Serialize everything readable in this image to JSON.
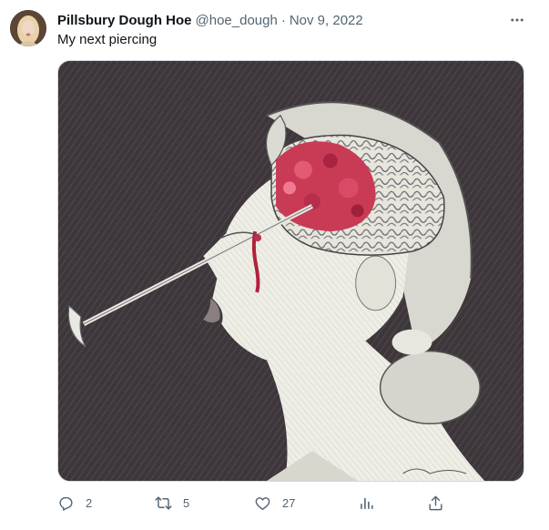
{
  "author": {
    "display_name": "Pillsbury Dough Hoe",
    "handle": "@hoe_dough",
    "separator": "·",
    "date": "Nov 9, 2022",
    "avatar_icon": "profile-photo"
  },
  "tweet": {
    "text": "My next piercing",
    "media_description_icon": "artwork-image"
  },
  "actions": {
    "reply": {
      "icon": "reply-icon",
      "count": "2"
    },
    "retweet": {
      "icon": "retweet-icon",
      "count": "5"
    },
    "like": {
      "icon": "heart-icon",
      "count": "27"
    },
    "views": {
      "icon": "analytics-icon"
    },
    "share": {
      "icon": "share-icon"
    }
  },
  "colors": {
    "text_primary": "#0f1419",
    "text_secondary": "#536471",
    "border": "#cfd9de"
  }
}
